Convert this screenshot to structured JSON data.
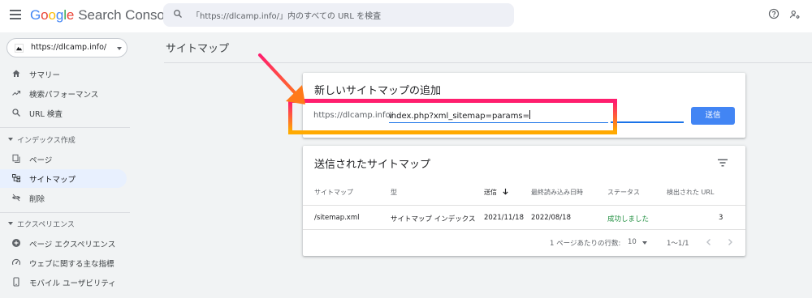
{
  "header": {
    "menu_icon": "hamburger-menu-icon",
    "logo_google": "Google",
    "logo_product": "Search Console",
    "search_placeholder": "「https://dlcamp.info/」内のすべての URL を検査",
    "icons": [
      "search-icon",
      "help-icon",
      "account-settings-icon"
    ]
  },
  "colors": {
    "google_blue": "#4285F4",
    "google_red": "#EA4335",
    "google_yellow": "#FBBC05",
    "google_green": "#34A853",
    "accent": "#1A73E8",
    "active_nav_bg": "#E8F0FE",
    "success": "#1E8E3E",
    "highlight_pink": "#FF1E6E",
    "highlight_orange": "#FFAB00"
  },
  "sidebar": {
    "property": {
      "label": "https://dlcamp.info/"
    },
    "items": [
      {
        "label": "サマリー",
        "icon": "home-icon"
      },
      {
        "label": "検索パフォーマンス",
        "icon": "trending-up-icon"
      },
      {
        "label": "URL 検査",
        "icon": "search-icon"
      }
    ],
    "sections": [
      {
        "label": "インデックス作成",
        "items": [
          {
            "label": "ページ",
            "icon": "pages-icon"
          },
          {
            "label": "サイトマップ",
            "icon": "sitemap-icon",
            "active": true
          },
          {
            "label": "削除",
            "icon": "visibility-off-icon"
          }
        ]
      },
      {
        "label": "エクスペリエンス",
        "items": [
          {
            "label": "ページ エクスペリエンス",
            "icon": "add-circle-icon"
          },
          {
            "label": "ウェブに関する主な指標",
            "icon": "speed-gauge-icon"
          },
          {
            "label": "モバイル ユーザビリティ",
            "icon": "smartphone-icon"
          }
        ]
      }
    ]
  },
  "main": {
    "page_title": "サイトマップ",
    "add_card": {
      "title": "新しいサイトマップの追加",
      "url_prefix": "https://dlcamp.info/",
      "input_value": "index.php?xml_sitemap=params=",
      "submit_label": "送信"
    },
    "submitted_card": {
      "title": "送信されたサイトマップ",
      "filter_icon": "filter-list-icon",
      "columns": [
        "サイトマップ",
        "型",
        "送信",
        "最終読み込み日時",
        "ステータス",
        "検出された URL"
      ],
      "sorted_column": "送信",
      "rows": [
        {
          "sitemap": "/sitemap.xml",
          "type": "サイトマップ インデックス",
          "submitted": "2021/11/18",
          "last_read": "2022/08/18",
          "status": "成功しました",
          "discovered_urls": "3"
        }
      ],
      "pagination": {
        "rows_per_page_label": "1 ページあたりの行数:",
        "rows_per_page": "10",
        "range": "1〜1/1"
      }
    }
  }
}
